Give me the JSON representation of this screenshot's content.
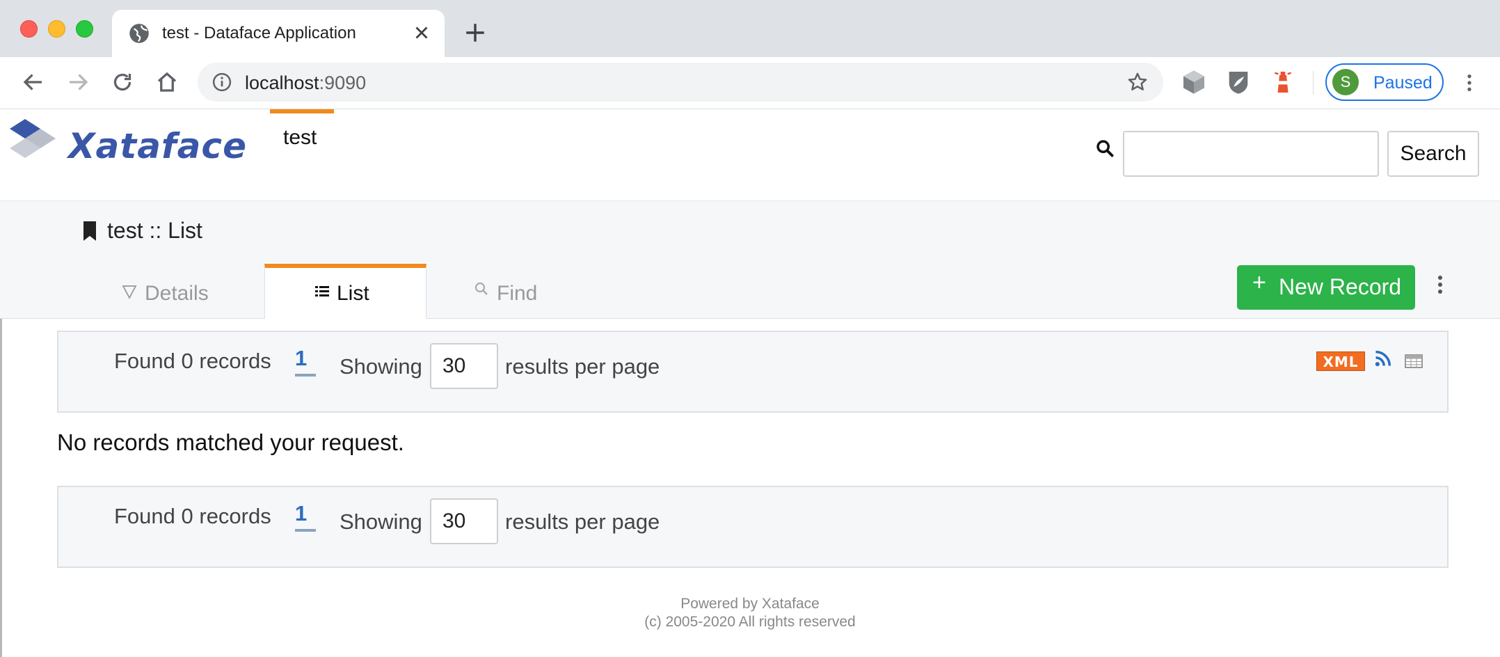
{
  "browser": {
    "tab_title": "test - Dataface Application",
    "url_host": "localhost",
    "url_port": ":9090",
    "profile_initial": "S",
    "profile_label": "Paused"
  },
  "header": {
    "logo_text": "Xataface",
    "app_tab_label": "test",
    "search_placeholder": "",
    "search_button": "Search"
  },
  "subhead": {
    "page_heading": "test :: List",
    "tabs": [
      {
        "label": "Details",
        "icon": "triangle-down-icon"
      },
      {
        "label": "List",
        "icon": "list-icon"
      },
      {
        "label": "Find",
        "icon": "search-icon"
      }
    ],
    "new_record_label": "New Record"
  },
  "results": {
    "found_text": "Found 0 records",
    "page_number": "1",
    "showing_text": "Showing",
    "per_page_value": "30",
    "per_page_label": "results per page",
    "xml_badge": "XML",
    "empty_message": "No records matched your request."
  },
  "footer": {
    "line1": "Powered by Xataface",
    "line2": "(c) 2005-2020 All rights reserved"
  },
  "colors": {
    "accent_orange": "#f08a1c",
    "new_record_green": "#2cb34a",
    "link_blue": "#2a6cc2",
    "chrome_blue": "#1a73e8"
  }
}
